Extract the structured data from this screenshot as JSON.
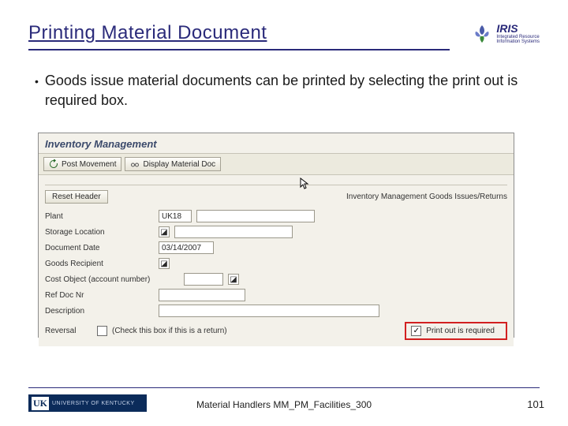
{
  "header": {
    "title": "Printing Material Document",
    "logo_text": "IRIS",
    "logo_sub1": "Integrated Resource",
    "logo_sub2": "Information Systems"
  },
  "bullet": "Goods issue material documents can be printed by selecting the print out is required box.",
  "screenshot": {
    "app_title": "Inventory Management",
    "toolbar": {
      "post_movement": "Post Movement",
      "display_material": "Display Material Doc"
    },
    "reset_header": "Reset Header",
    "mode_title": "Inventory Management Goods Issues/Returns",
    "fields": {
      "plant_label": "Plant",
      "plant_value": "UK18",
      "storage_label": "Storage Location",
      "document_date_label": "Document Date",
      "document_date_value": "03/14/2007",
      "goods_recipient_label": "Goods Recipient",
      "cost_object_label": "Cost Object (account number)",
      "ref_doc_label": "Ref Doc Nr",
      "description_label": "Description",
      "reversal_label": "Reversal",
      "reversal_hint": "(Check this box if this is a return)",
      "printout_label": "Print out is required"
    }
  },
  "footer": {
    "uk": "UK",
    "uk_text": "UNIVERSITY OF KENTUCKY",
    "center": "Material Handlers MM_PM_Facilities_300",
    "page": "101"
  }
}
